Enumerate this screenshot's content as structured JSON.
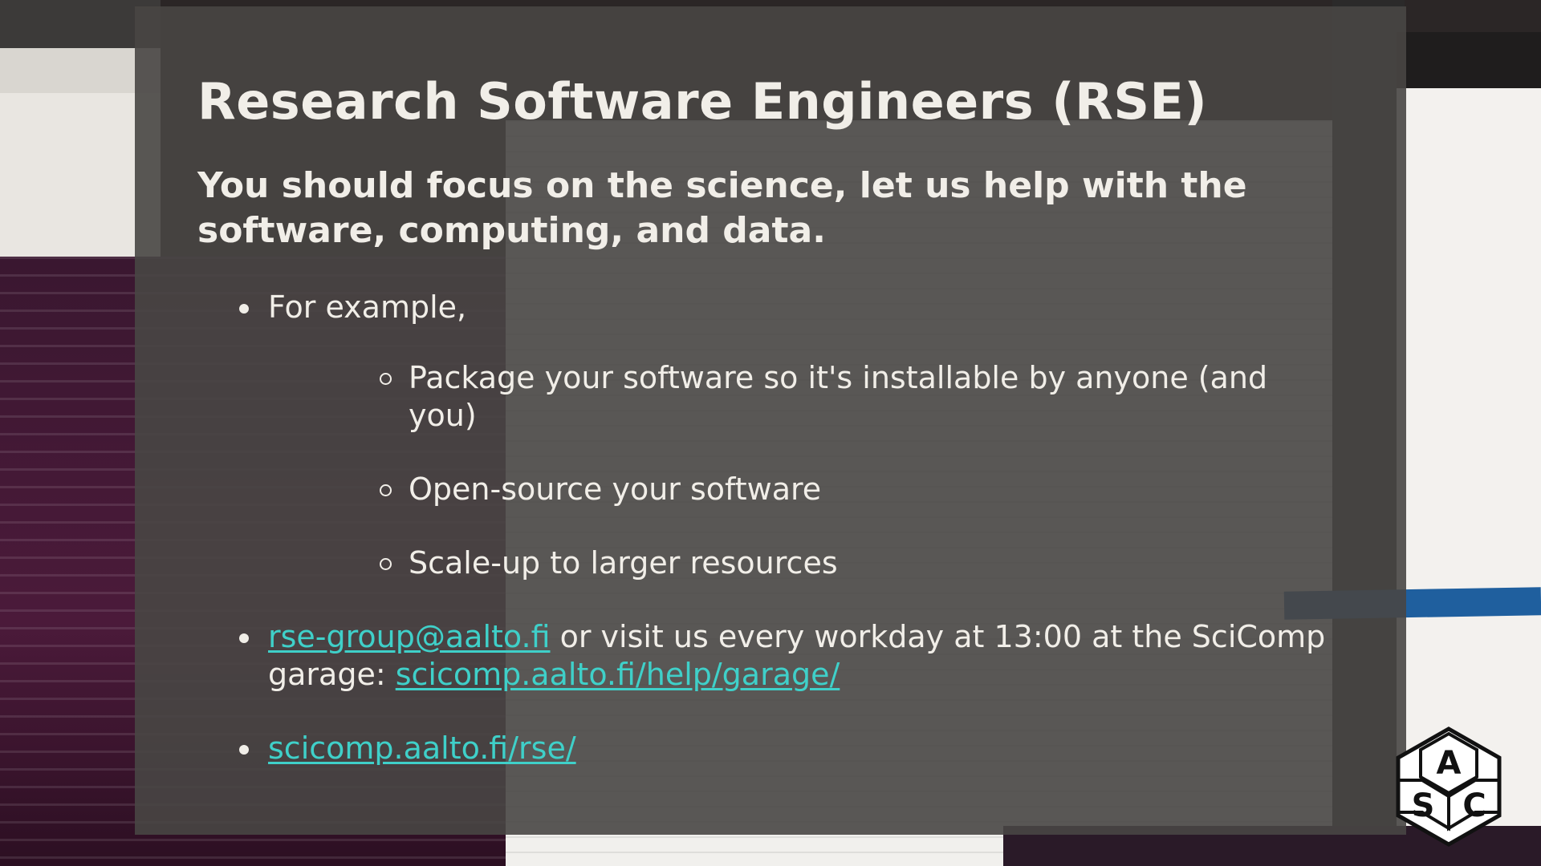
{
  "slide": {
    "title": "Research Software Engineers (RSE)",
    "subtitle": "You should focus on the science, let us help with the software, computing, and data.",
    "bullets": {
      "example": "For example,",
      "sub_items": [
        "Package your software so it's installable by anyone (and you)",
        "Open-source your software",
        "Scale-up to larger resources"
      ],
      "contact": {
        "email": "rse-group@aalto.fi",
        "text_middle": " or visit us every workday at 13:00 at the SciComp garage: ",
        "garage_link": "scicomp.aalto.fi/help/garage/"
      },
      "site_link": "scicomp.aalto.fi/rse/"
    }
  },
  "logo": {
    "letters": [
      "A",
      "S",
      "C"
    ]
  },
  "colors": {
    "slide_background": "#484644",
    "text": "#f1eee8",
    "link": "#3fd0c9"
  }
}
